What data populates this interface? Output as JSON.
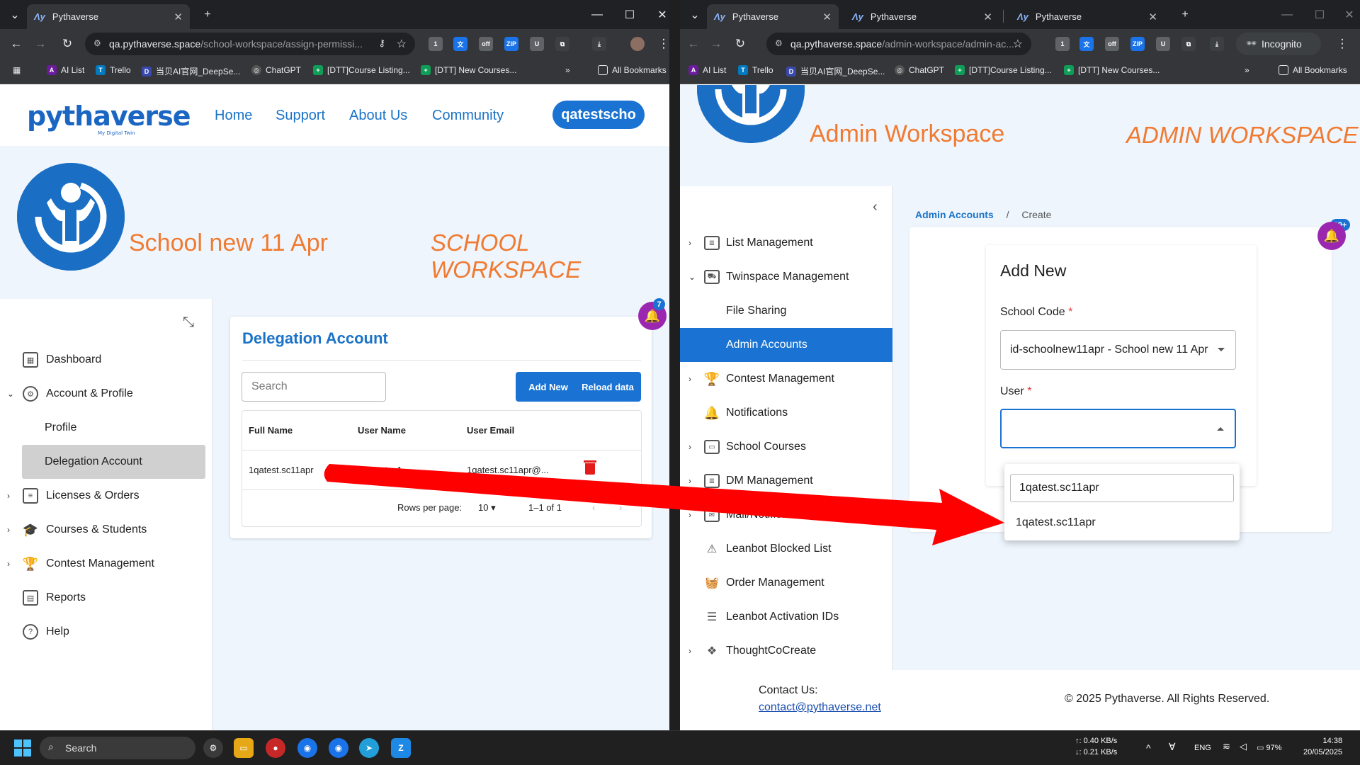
{
  "left_window": {
    "tabs": [
      {
        "title": "Pythaverse"
      }
    ],
    "url_host": "qa.pythaverse.space",
    "url_path": "/school-workspace/assign-permissi...",
    "bookmarks": [
      "AI List",
      "Trello",
      "当贝AI官网_DeepSe...",
      "ChatGPT",
      "[DTT]Course Listing...",
      "[DTT] New Courses...",
      "All Bookmarks"
    ],
    "header": {
      "logo": "pythaverse",
      "logo_tagline": "My Digital Twin",
      "nav": [
        "Home",
        "Support",
        "About Us",
        "Community"
      ],
      "user": "qatestscho"
    },
    "banner": {
      "school_name": "School new 11 Apr",
      "workspace_title": "SCHOOL WORKSPACE"
    },
    "sidebar": [
      {
        "label": "Dashboard",
        "icon": "grid-icon"
      },
      {
        "label": "Account & Profile",
        "icon": "gear-icon",
        "expanded": true
      },
      {
        "label": "Profile",
        "sub": true
      },
      {
        "label": "Delegation Account",
        "sub": true,
        "active": true
      },
      {
        "label": "Licenses & Orders",
        "icon": "document-icon"
      },
      {
        "label": "Courses & Students",
        "icon": "graduation-cap-icon"
      },
      {
        "label": "Contest Management",
        "icon": "trophy-icon"
      },
      {
        "label": "Reports",
        "icon": "table-icon"
      },
      {
        "label": "Help",
        "icon": "help-icon"
      }
    ],
    "card": {
      "title": "Delegation Account",
      "search_placeholder": "Search",
      "add_new": "Add New",
      "reload": "Reload data",
      "columns": [
        "Full Name",
        "User Name",
        "User Email"
      ],
      "rows": [
        {
          "full_name": "1qatest.sc11apr",
          "user_name": "1qatestsc1",
          "email": "1qatest.sc11apr@..."
        }
      ],
      "rows_per_page_label": "Rows per page:",
      "rows_per_page": "10",
      "range": "1–1 of 1"
    },
    "notification_count": "7"
  },
  "right_window": {
    "tabs": [
      {
        "title": "Pythaverse"
      },
      {
        "title": "Pythaverse"
      },
      {
        "title": "Pythaverse"
      }
    ],
    "url_host": "qa.pythaverse.space",
    "url_path": "/admin-workspace/admin-ac...",
    "incognito": "Incognito",
    "bookmarks": [
      "AI List",
      "Trello",
      "当贝AI官网_DeepSe...",
      "ChatGPT",
      "[DTT]Course Listing...",
      "[DTT] New Courses...",
      "All Bookmarks"
    ],
    "banner": {
      "name": "Admin Workspace",
      "workspace_title": "ADMIN WORKSPACE"
    },
    "sidebar": [
      {
        "label": "List Management",
        "chevron": "right"
      },
      {
        "label": "Twinspace Management",
        "chevron": "down"
      },
      {
        "label": "File Sharing",
        "sub": true
      },
      {
        "label": "Admin Accounts",
        "sub": true,
        "active": true
      },
      {
        "label": "Contest Management",
        "chevron": "right"
      },
      {
        "label": "Notifications"
      },
      {
        "label": "School Courses",
        "chevron": "right"
      },
      {
        "label": "DM Management",
        "chevron": "right"
      },
      {
        "label": "Mail/Notification Config",
        "chevron": "right"
      },
      {
        "label": "Leanbot Blocked List"
      },
      {
        "label": "Order Management"
      },
      {
        "label": "Leanbot Activation IDs"
      },
      {
        "label": "ThoughtCoCreate",
        "chevron": "right"
      }
    ],
    "breadcrumb": {
      "parent": "Admin Accounts",
      "separator": "/",
      "current": "Create"
    },
    "form": {
      "title": "Add New",
      "school_code_label": "School Code",
      "school_code_value": "id-schoolnew11apr - School new 11 Apr",
      "user_label": "User",
      "user_value": "",
      "dropdown_search": "1qatest.sc11apr",
      "dropdown_option": "1qatest.sc11apr"
    },
    "notification_count": "99+",
    "footer": {
      "contact_label": "Contact Us:",
      "contact_email": "contact@pythaverse.net",
      "copyright": "© 2025 Pythaverse. All Rights Reserved."
    }
  },
  "taskbar": {
    "search": "Search",
    "net_up": "↑: 0.40 KB/s",
    "net_down": "↓: 0.21 KB/s",
    "lang": "ENG",
    "battery": "97%",
    "time": "14:38",
    "date": "20/05/2025"
  },
  "colors": {
    "brand_blue": "#1a73d2",
    "accent_orange": "#f07a30",
    "bell_purple": "#9b27b0",
    "arrow_red": "#ff0000"
  }
}
